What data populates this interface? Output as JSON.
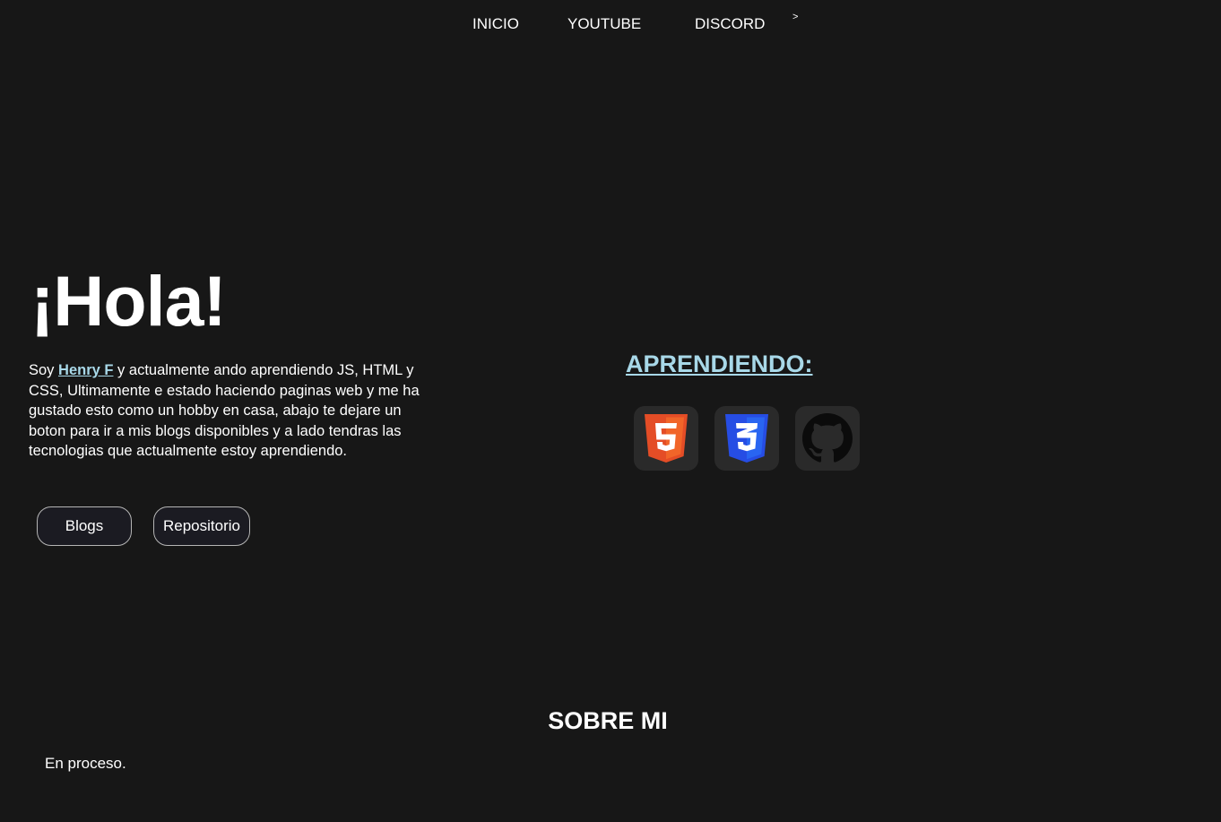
{
  "nav": {
    "items": [
      {
        "label": "INICIO"
      },
      {
        "label": "YOUTUBE"
      },
      {
        "label": "DISCORD"
      }
    ],
    "more_label": ">"
  },
  "hero": {
    "title": "¡Hola!",
    "intro_prefix": "Soy ",
    "name_link": "Henry F",
    "intro_body": " y actualmente ando aprendiendo JS, HTML y CSS, Ultimamente e estado haciendo paginas web y me ha gustado esto como un hobby en casa, abajo te dejare un boton para ir a mis blogs disponibles y a lado tendras las tecnologias que actualmente estoy aprendiendo.",
    "buttons": {
      "blogs": "Blogs",
      "repo": "Repositorio"
    }
  },
  "learning": {
    "title": "APRENDIENDO:",
    "icons": [
      "html5-icon",
      "css3-icon",
      "github-icon"
    ]
  },
  "about": {
    "title": "SOBRE MI",
    "text": "En proceso."
  },
  "colors": {
    "background": "#171717",
    "accent": "#a8d8e8",
    "html5": "#e44d26",
    "css3": "#264de4"
  }
}
